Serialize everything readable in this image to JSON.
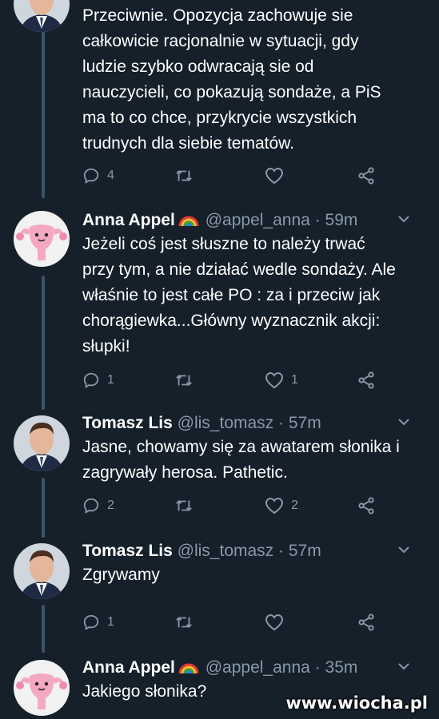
{
  "tweets": [
    {
      "author": "",
      "handle": "",
      "time": "",
      "text": "Przeciwnie. Opozycja zachowuje sie\ncałkowicie racjonalnie w sytuacji, gdy\nludzie szybko odwracają sie od\nnauczycieli, co pokazują sondaże, a PiS\nma to co chce, przykrycie wszystkich\ntrudnych dla siebie tematów.",
      "replies": "4",
      "retweets": "",
      "likes": "",
      "avatar": "man-portrait"
    },
    {
      "author": "Anna Appel",
      "handle": "@appel_anna",
      "time": "59m",
      "text": "Jeżeli coś jest słuszne to należy trwać\nprzy tym, a nie działać wedle sondaży. Ale\nwłaśnie to jest całe PO : za i przeciw jak\nchorągiewka...Główny wyznacznik akcji:\nsłupki!",
      "replies": "1",
      "retweets": "",
      "likes": "1",
      "avatar": "pink-uterus-plush"
    },
    {
      "author": "Tomasz Lis",
      "handle": "@lis_tomasz",
      "time": "57m",
      "text": "Jasne, chowamy się za awatarem słonika i\nzagrywały herosa. Pathetic.",
      "replies": "2",
      "retweets": "",
      "likes": "2",
      "avatar": "man-portrait"
    },
    {
      "author": "Tomasz Lis",
      "handle": "@lis_tomasz",
      "time": "57m",
      "text": "Zgrywamy",
      "replies": "1",
      "retweets": "",
      "likes": "",
      "avatar": "man-portrait"
    },
    {
      "author": "Anna Appel",
      "handle": "@appel_anna",
      "time": "35m",
      "text": "Jakiego słonika?",
      "replies": "",
      "retweets": "",
      "likes": "",
      "avatar": "pink-uterus-plush"
    }
  ],
  "separator": "·",
  "watermark": "www.wiocha.pl",
  "colors": {
    "background": "#15202b",
    "secondary_text": "#8899a6",
    "thread_line": "#3d5466",
    "avatar_pink": "#f4a8c4"
  },
  "icons": {
    "reply": "reply-icon",
    "retweet": "retweet-icon",
    "like": "heart-icon",
    "share": "share-icon",
    "more": "chevron-down-icon",
    "emoji": "rainbow-icon"
  }
}
